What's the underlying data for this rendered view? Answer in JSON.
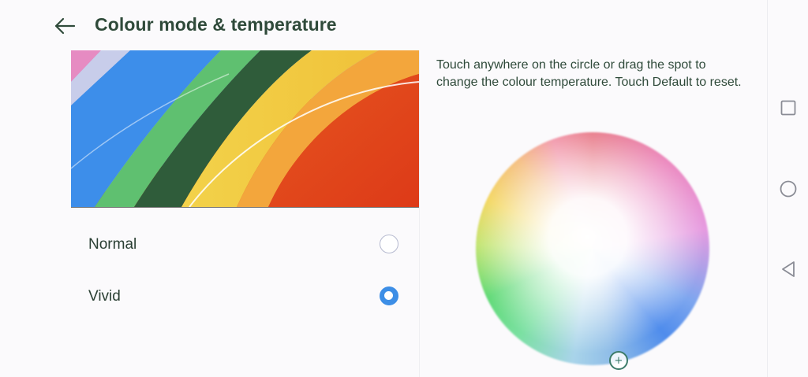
{
  "header": {
    "title": "Colour mode & temperature",
    "back_icon": "arrow-left-icon"
  },
  "preview": {
    "description_icon": "rainbow-wallpaper-preview"
  },
  "colour_modes": {
    "options": [
      {
        "label": "Normal",
        "selected": false
      },
      {
        "label": "Vivid",
        "selected": true
      }
    ]
  },
  "temperature": {
    "instructions": "Touch anywhere on the circle or drag the spot to change the colour temperature. Touch Default to reset.",
    "handle_symbol": "+"
  },
  "navigation": {
    "recent_icon": "square-icon",
    "home_icon": "circle-icon",
    "back_icon": "triangle-back-icon"
  },
  "colors": {
    "title_text": "#2f4a3a",
    "accent_blue": "#3d8ee6",
    "handle_green": "#3c7b6a"
  }
}
